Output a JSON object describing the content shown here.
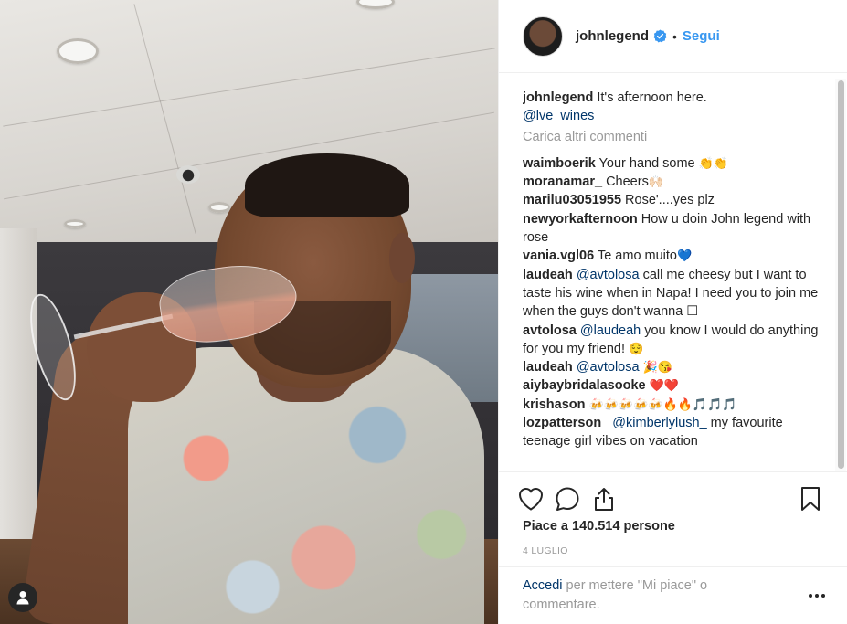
{
  "post": {
    "username": "johnlegend",
    "follow_label": "Segui",
    "separator": "•",
    "caption": {
      "user": "johnlegend",
      "text": " It's afternoon here.",
      "mention": "@lve_wines"
    },
    "load_more_label": "Carica altri commenti",
    "comments": [
      {
        "user": "waimboerik",
        "parts": [
          {
            "t": " Your hand some "
          },
          {
            "e": "👏👏"
          }
        ]
      },
      {
        "user": "moranamar_",
        "parts": [
          {
            "t": " Cheers"
          },
          {
            "e": "🙌🏻"
          }
        ]
      },
      {
        "user": "marilu03051955",
        "parts": [
          {
            "t": " Rose'....yes plz"
          }
        ]
      },
      {
        "user": "newyorkafternoon",
        "parts": [
          {
            "t": " How u doin John legend with rose"
          }
        ]
      },
      {
        "user": "vania.vgl06",
        "parts": [
          {
            "t": " Te amo muito"
          },
          {
            "e": "💙"
          }
        ]
      },
      {
        "user": "laudeah",
        "parts": [
          {
            "m": " @avtolosa"
          },
          {
            "t": " call me cheesy but I want to taste his wine when in Napa! I need you to join me when the guys don't wanna ☐"
          }
        ]
      },
      {
        "user": "avtolosa",
        "parts": [
          {
            "m": " @laudeah"
          },
          {
            "t": " you know I would do anything for you my friend! "
          },
          {
            "e": "😌"
          }
        ]
      },
      {
        "user": "laudeah",
        "parts": [
          {
            "m": " @avtolosa"
          },
          {
            "t": " "
          },
          {
            "e": "🎉😘"
          }
        ]
      },
      {
        "user": "aiybaybridalasooke",
        "parts": [
          {
            "t": " "
          },
          {
            "e": "❤️❤️"
          }
        ]
      },
      {
        "user": "krishason",
        "parts": [
          {
            "t": " "
          },
          {
            "e": "🍻🍻🍻🍻🍻🔥🔥🎵🎵🎵"
          }
        ]
      },
      {
        "user": "lozpatterson_",
        "parts": [
          {
            "m": " @kimberlylush_"
          },
          {
            "t": " my favourite teenage girl vibes on vacation"
          }
        ]
      }
    ],
    "likes_label": "Piace a 140.514 persone",
    "date_label": "4 LUGLIO",
    "login_link": "Accedi",
    "login_rest": " per mettere \"Mi piace\" o commentare.",
    "more_label": "•••"
  },
  "icons": {
    "verified": "verified-badge-icon",
    "like": "heart-icon",
    "comment": "speech-bubble-icon",
    "share": "share-icon",
    "save": "bookmark-icon",
    "user": "user-tag-icon",
    "more": "ellipsis-icon"
  },
  "colors": {
    "link_blue": "#3897f0",
    "mention_blue": "#003569",
    "muted": "#999999",
    "text": "#262626"
  }
}
